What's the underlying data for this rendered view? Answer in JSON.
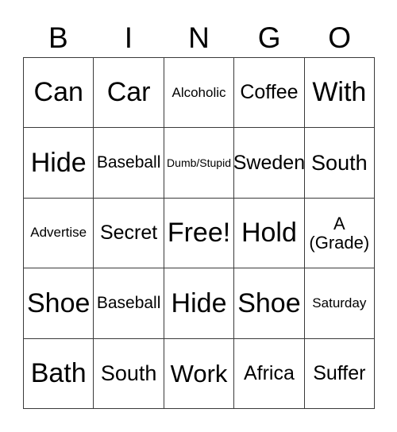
{
  "card": {
    "header": {
      "letters": [
        "B",
        "I",
        "N",
        "G",
        "O"
      ]
    },
    "colors": {
      "border": "#3a3a3a",
      "text": "#000000",
      "background": "#ffffff"
    },
    "rows": [
      [
        {
          "text": "Can",
          "size": "fs-xxl"
        },
        {
          "text": "Car",
          "size": "fs-xxl"
        },
        {
          "text": "Alcoholic",
          "size": "fs-xxs"
        },
        {
          "text": "Coffee",
          "size": "fs-m"
        },
        {
          "text": "With",
          "size": "fs-xxl"
        }
      ],
      [
        {
          "text": "Hide",
          "size": "fs-xxl"
        },
        {
          "text": "Baseball",
          "size": "fs-xs"
        },
        {
          "text": "Dumb/Stupid",
          "size": "fs-tiny"
        },
        {
          "text": "Sweden",
          "size": "fs-m"
        },
        {
          "text": "South",
          "size": "fs-l"
        }
      ],
      [
        {
          "text": "Advertise",
          "size": "fs-xxs"
        },
        {
          "text": "Secret",
          "size": "fs-m"
        },
        {
          "text": "Free!",
          "size": "fs-xxl"
        },
        {
          "text": "Hold",
          "size": "fs-xxl"
        },
        {
          "text": "A\n(Grade)",
          "size": "fs-s"
        }
      ],
      [
        {
          "text": "Shoe",
          "size": "fs-xxl"
        },
        {
          "text": "Baseball",
          "size": "fs-xs"
        },
        {
          "text": "Hide",
          "size": "fs-xxl"
        },
        {
          "text": "Shoe",
          "size": "fs-xxl"
        },
        {
          "text": "Saturday",
          "size": "fs-xxs"
        }
      ],
      [
        {
          "text": "Bath",
          "size": "fs-xxl"
        },
        {
          "text": "South",
          "size": "fs-l"
        },
        {
          "text": "Work",
          "size": "fs-xl"
        },
        {
          "text": "Africa",
          "size": "fs-m"
        },
        {
          "text": "Suffer",
          "size": "fs-m"
        }
      ]
    ]
  }
}
